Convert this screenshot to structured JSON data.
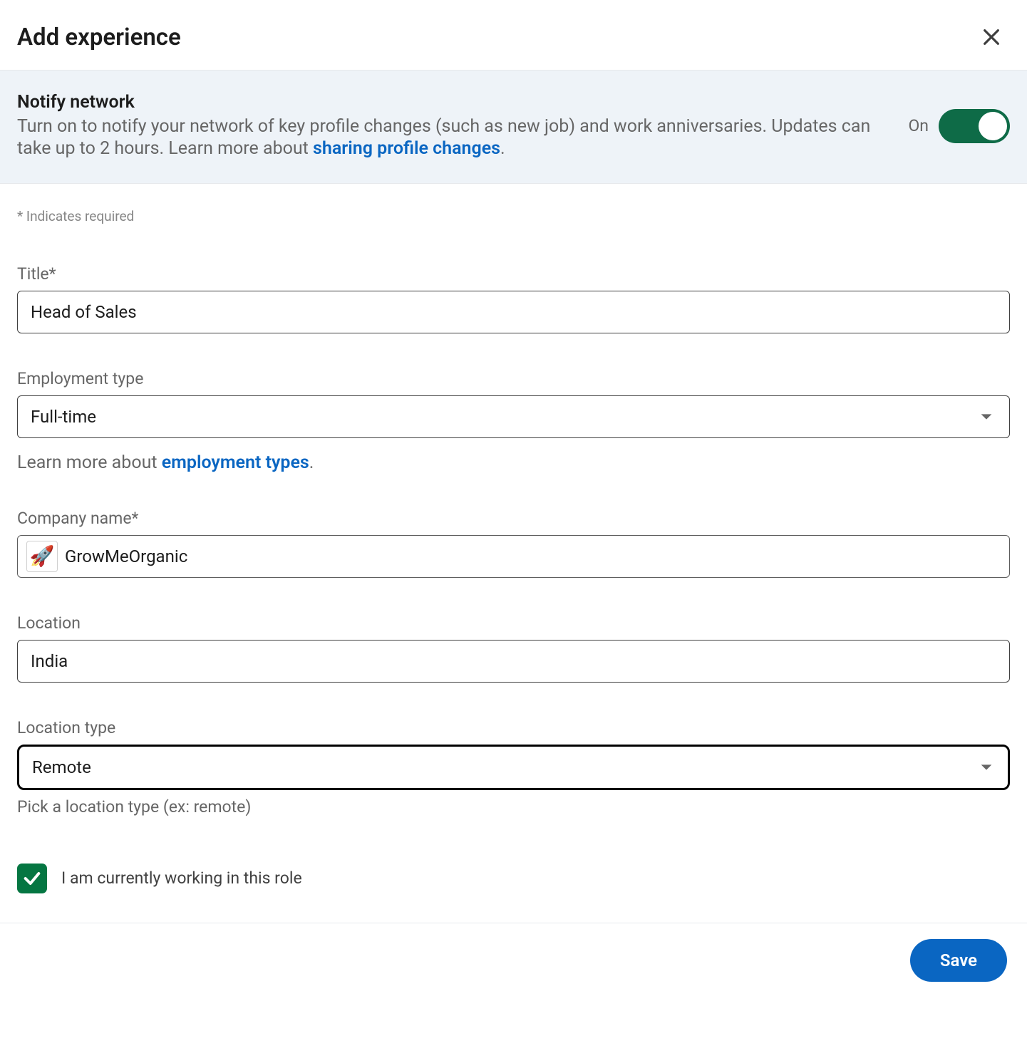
{
  "header": {
    "title": "Add experience"
  },
  "notify": {
    "heading": "Notify network",
    "desc_prefix": "Turn on to notify your network of key profile changes (such as new job) and work anniversaries. Updates can take up to 2 hours. Learn more about ",
    "link_text": "sharing profile changes",
    "desc_suffix": ".",
    "state_label": "On"
  },
  "required_note": "* Indicates required",
  "fields": {
    "title": {
      "label": "Title*",
      "value": "Head of Sales"
    },
    "employment_type": {
      "label": "Employment type",
      "value": "Full-time",
      "help_prefix": "Learn more about ",
      "help_link": "employment types",
      "help_suffix": "."
    },
    "company": {
      "label": "Company name*",
      "value": "GrowMeOrganic",
      "logo_icon": "rocket-icon"
    },
    "location": {
      "label": "Location",
      "value": "India"
    },
    "location_type": {
      "label": "Location type",
      "value": "Remote",
      "hint": "Pick a location type (ex: remote)"
    }
  },
  "currently_working": {
    "label": "I am currently working in this role",
    "checked": true
  },
  "footer": {
    "save_label": "Save"
  }
}
